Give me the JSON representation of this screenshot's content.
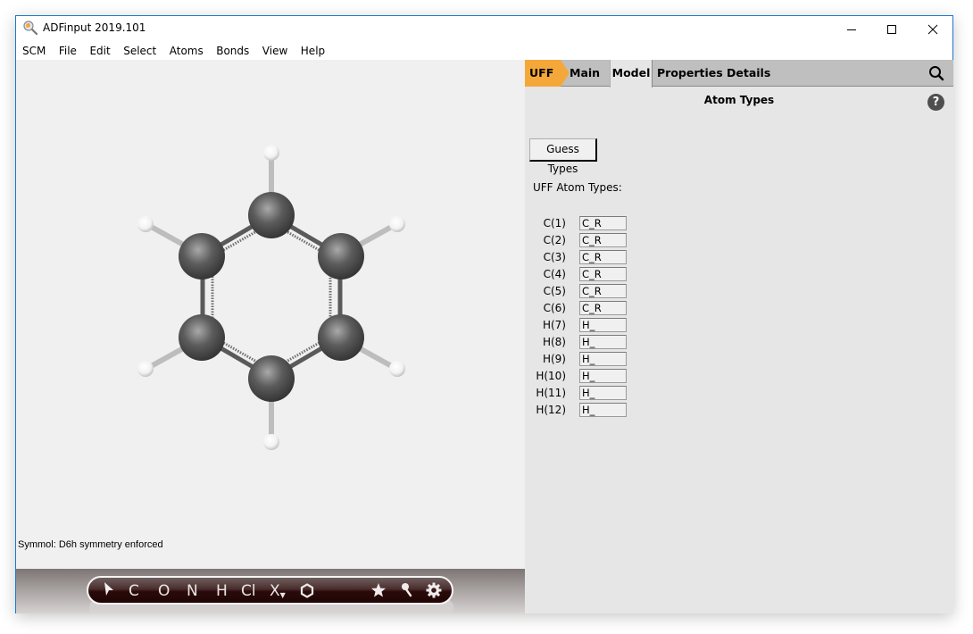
{
  "window": {
    "title": "ADFinput 2019.101",
    "app_icon": "magnifier-icon",
    "controls": [
      "minimize",
      "maximize",
      "close"
    ]
  },
  "menubar": {
    "items": [
      "SCM",
      "File",
      "Edit",
      "Select",
      "Atoms",
      "Bonds",
      "View",
      "Help"
    ]
  },
  "viewport": {
    "molecule": "benzene",
    "status": "Symmol: D6h symmetry enforced"
  },
  "toolbar": {
    "items": [
      {
        "id": "select",
        "icon": "pointer-arrow-icon"
      },
      {
        "id": "carbon",
        "label": "C"
      },
      {
        "id": "oxygen",
        "label": "O"
      },
      {
        "id": "nitrogen",
        "label": "N"
      },
      {
        "id": "hydrogen",
        "label": "H"
      },
      {
        "id": "chlorine",
        "label": "Cl"
      },
      {
        "id": "other-element",
        "label": "X"
      },
      {
        "id": "ring",
        "icon": "hexagon-icon"
      },
      {
        "id": "favorites",
        "icon": "star-icon"
      },
      {
        "id": "tools",
        "icon": "pin-icon"
      },
      {
        "id": "settings",
        "icon": "gear-icon"
      }
    ]
  },
  "panel": {
    "tabs": [
      {
        "label": "UFF",
        "style": "accent"
      },
      {
        "label": "Main"
      },
      {
        "label": "Model",
        "active": true
      },
      {
        "label": "Properties"
      },
      {
        "label": "Details"
      }
    ],
    "accent_color": "#f5a83a",
    "section_title": "Atom Types",
    "help_label": "?",
    "guess_button": "Guess Types",
    "types_label": "UFF Atom Types:",
    "atoms": [
      {
        "label": "C(1)",
        "value": "C_R"
      },
      {
        "label": "C(2)",
        "value": "C_R"
      },
      {
        "label": "C(3)",
        "value": "C_R"
      },
      {
        "label": "C(4)",
        "value": "C_R"
      },
      {
        "label": "C(5)",
        "value": "C_R"
      },
      {
        "label": "C(6)",
        "value": "C_R"
      },
      {
        "label": "H(7)",
        "value": "H_"
      },
      {
        "label": "H(8)",
        "value": "H_"
      },
      {
        "label": "H(9)",
        "value": "H_"
      },
      {
        "label": "H(10)",
        "value": "H_"
      },
      {
        "label": "H(11)",
        "value": "H_"
      },
      {
        "label": "H(12)",
        "value": "H_"
      }
    ]
  }
}
